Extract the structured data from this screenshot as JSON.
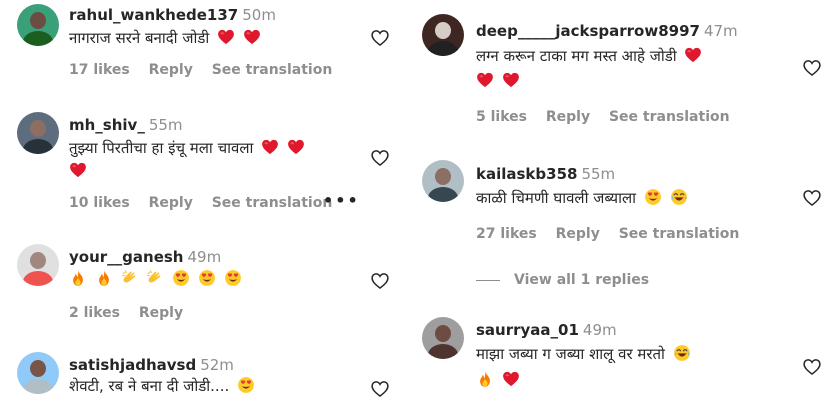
{
  "left_column": [
    {
      "username": "rahul_wankhede137",
      "time": "50m",
      "text": "नागराज सरने बनादी जोडी",
      "emojis": [
        "red-heart",
        "red-heart"
      ],
      "likes": "17 likes",
      "reply": "Reply",
      "see_translation": "See translation",
      "avatar_colors": {
        "bg": "#3aa07a",
        "head": "#6d4c41",
        "body": "#1b5e20"
      }
    },
    {
      "username": "mh_shiv_",
      "time": "55m",
      "text": "तुझ्या पिरतीचा हा इंचू मला चावला",
      "emojis": [
        "red-heart",
        "red-heart"
      ],
      "emojis_line2": [
        "red-heart"
      ],
      "likes": "10 likes",
      "reply": "Reply",
      "see_translation": "See translation",
      "more": "•••",
      "avatar_colors": {
        "bg": "#5d6d7e",
        "head": "#8d6e63",
        "body": "#263238"
      }
    },
    {
      "username": "your__ganesh",
      "time": "49m",
      "emojis": [
        "fire",
        "fire",
        "clapping-hands",
        "clapping-hands",
        "heart-eyes-face",
        "heart-eyes-face",
        "heart-eyes-face"
      ],
      "likes": "2 likes",
      "reply": "Reply",
      "avatar_colors": {
        "bg": "#e0e0e0",
        "head": "#a1887f",
        "body": "#ef5350"
      }
    },
    {
      "username": "satishjadhavsd",
      "time": "52m",
      "text": "शेवटी, रब ने बना दी जोडी....",
      "emojis": [
        "heart-eyes-face"
      ],
      "avatar_colors": {
        "bg": "#90caf9",
        "head": "#795548",
        "body": "#b0bec5"
      }
    }
  ],
  "right_column": [
    {
      "username": "deep_____jacksparrow8997",
      "time": "47m",
      "text": "लग्न करून टाका मग मस्त आहे जोडी",
      "emojis": [
        "red-heart"
      ],
      "emojis_line2": [
        "red-heart",
        "red-heart"
      ],
      "likes": "5 likes",
      "reply": "Reply",
      "see_translation": "See translation",
      "avatar_colors": {
        "bg": "#3e2723",
        "head": "#d7ccc8",
        "body": "#212121"
      }
    },
    {
      "username": "kailaskb358",
      "time": "55m",
      "text": "काळी चिमणी घावली जब्याला",
      "emojis": [
        "heart-eyes-face",
        "laughing-face"
      ],
      "likes": "27 likes",
      "reply": "Reply",
      "see_translation": "See translation",
      "view_replies": "View all 1 replies",
      "avatar_colors": {
        "bg": "#b0bec5",
        "head": "#8d6e63",
        "body": "#37474f"
      }
    },
    {
      "username": "saurryaa_01",
      "time": "49m",
      "text": "माझा जब्या ग जब्या शालू वर मरतो",
      "emojis": [
        "laughing-face"
      ],
      "emojis_line2": [
        "fire",
        "red-heart"
      ],
      "avatar_colors": {
        "bg": "#9e9e9e",
        "head": "#6d4c41",
        "body": "#4e342e"
      }
    }
  ],
  "colors": {
    "text": "#262626",
    "secondary": "#8e8e8e",
    "heart_red": "#ed1c24",
    "background": "#ffffff"
  }
}
